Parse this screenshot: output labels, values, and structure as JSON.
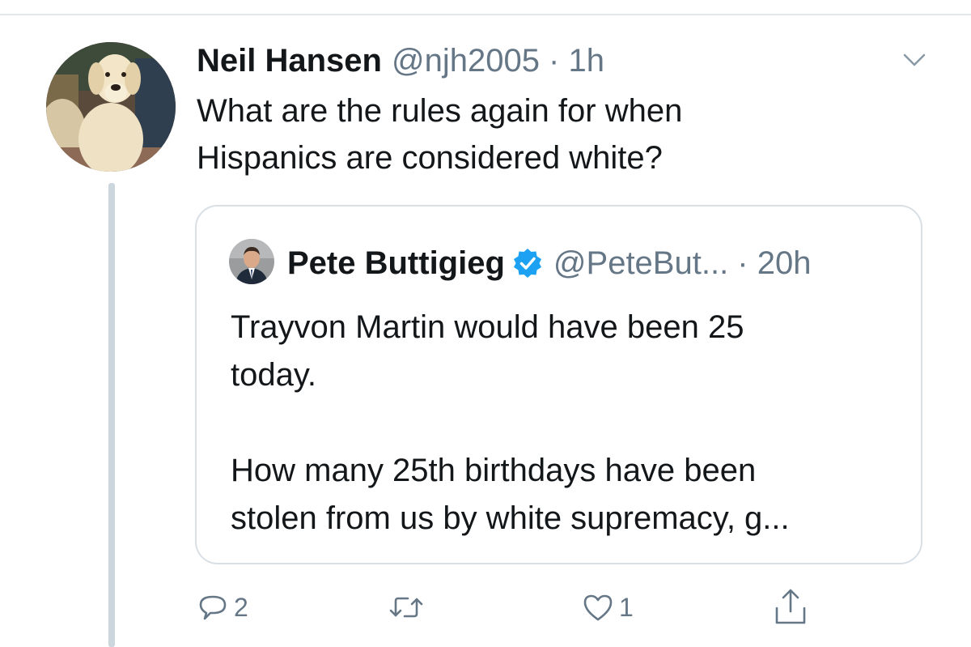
{
  "tweet": {
    "author_name": "Neil Hansen",
    "handle_meta": "@njh2005 · 1h",
    "text": "What are the rules again for when\nHispanics are considered white?",
    "avatar_icon": "dog-avatar-icon",
    "menu_icon": "chevron-down-icon"
  },
  "quoted": {
    "author_name": "Pete Buttigieg",
    "verified_icon": "verified-badge-icon",
    "handle_meta": "@PeteBut... · 20h",
    "text": "Trayvon Martin would have been 25\ntoday.\n\nHow many 25th birthdays have been\nstolen from us by white supremacy, g..."
  },
  "actions": {
    "reply_count": "2",
    "retweet_count": "",
    "like_count": "1",
    "reply_icon": "reply-icon",
    "retweet_icon": "retweet-icon",
    "like_icon": "heart-icon",
    "share_icon": "share-icon"
  },
  "colors": {
    "text_primary": "#14171a",
    "text_secondary": "#657786",
    "verified_blue": "#1da1f2",
    "border": "#d8dfe5",
    "thread_line": "#ccd6dd"
  }
}
